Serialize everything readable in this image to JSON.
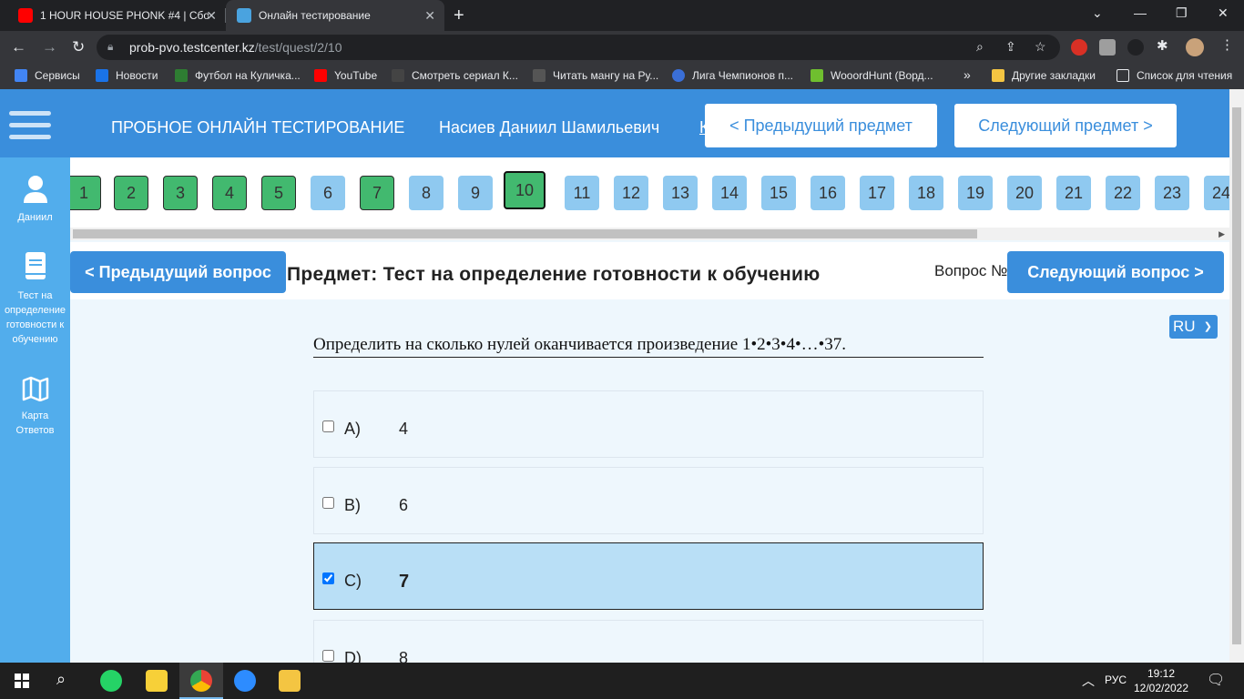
{
  "browser": {
    "tabs": [
      {
        "title": "1 HOUR HOUSE PHONK #4 | Сбо",
        "close": "✕"
      },
      {
        "title": "Онлайн тестирование",
        "close": "✕"
      }
    ],
    "new_tab": "+",
    "url_host": "prob-pvo.testcenter.kz",
    "url_path": "/test/quest/2/10",
    "bookmarks": [
      {
        "label": "Сервисы",
        "color": "#4285f4"
      },
      {
        "label": "Новости",
        "color": "#1a73e8"
      },
      {
        "label": "Футбол на Куличка...",
        "color": "#2e7d32"
      },
      {
        "label": "YouTube",
        "color": "#ff0000"
      },
      {
        "label": "Смотреть сериал К...",
        "color": "#444444"
      },
      {
        "label": "Читать мангу на Ру...",
        "color": "#555555"
      },
      {
        "label": "Лига Чемпионов п...",
        "color": "#3a6fd8"
      },
      {
        "label": "WooordHunt (Ворд...",
        "color": "#6fbf2f"
      }
    ],
    "more_bookmarks": "»",
    "other_bookmarks": "Другие закладки",
    "reading_list": "Список для чтения"
  },
  "header": {
    "title": "ПРОБНОЕ ОНЛАЙН ТЕСТИРОВАНИЕ",
    "user": "Насиев Даниил Шамильевич",
    "link_fragment": "К",
    "prev_subject": "< Предыдущий предмет",
    "next_subject": "Следующий предмет >"
  },
  "sidebar": {
    "user": "Даниил",
    "subject": "Тест на определение готовности к обучению",
    "answers_map": "Карта Ответов"
  },
  "question_nav": {
    "numbers": [
      "1",
      "2",
      "3",
      "4",
      "5",
      "6",
      "7",
      "8",
      "9",
      "10",
      "11",
      "12",
      "13",
      "14",
      "15",
      "16",
      "17",
      "18",
      "19",
      "20",
      "21",
      "22",
      "23",
      "24"
    ],
    "states": [
      "done",
      "done",
      "done",
      "done",
      "done",
      "todo",
      "done",
      "todo",
      "todo",
      "current",
      "todo",
      "todo",
      "todo",
      "todo",
      "todo",
      "todo",
      "todo",
      "todo",
      "todo",
      "todo",
      "todo",
      "todo",
      "todo",
      "todo"
    ]
  },
  "subject_bar": {
    "subject_text": "Предмет: Тест на определение готовности к обучению",
    "question_label": "Вопрос №",
    "prev_question": "< Предыдущий вопрос",
    "next_question": "Следующий вопрос >"
  },
  "language": "RU",
  "question": {
    "text": "Определить на сколько нулей оканчивается произведение 1•2•3•4•…•37.",
    "answers": [
      {
        "letter": "A)",
        "value": "4",
        "checked": false
      },
      {
        "letter": "B)",
        "value": "6",
        "checked": false
      },
      {
        "letter": "C)",
        "value": "7",
        "checked": true
      },
      {
        "letter": "D)",
        "value": "8",
        "checked": false
      }
    ]
  },
  "taskbar": {
    "lang": "РУС",
    "time": "19:12",
    "date": "12/02/2022"
  },
  "colors": {
    "accent": "#3a8edc",
    "sidebar": "#52adec",
    "done": "#42b96f",
    "todo": "#8fc9f0",
    "selected_answer": "#b9dff6"
  }
}
